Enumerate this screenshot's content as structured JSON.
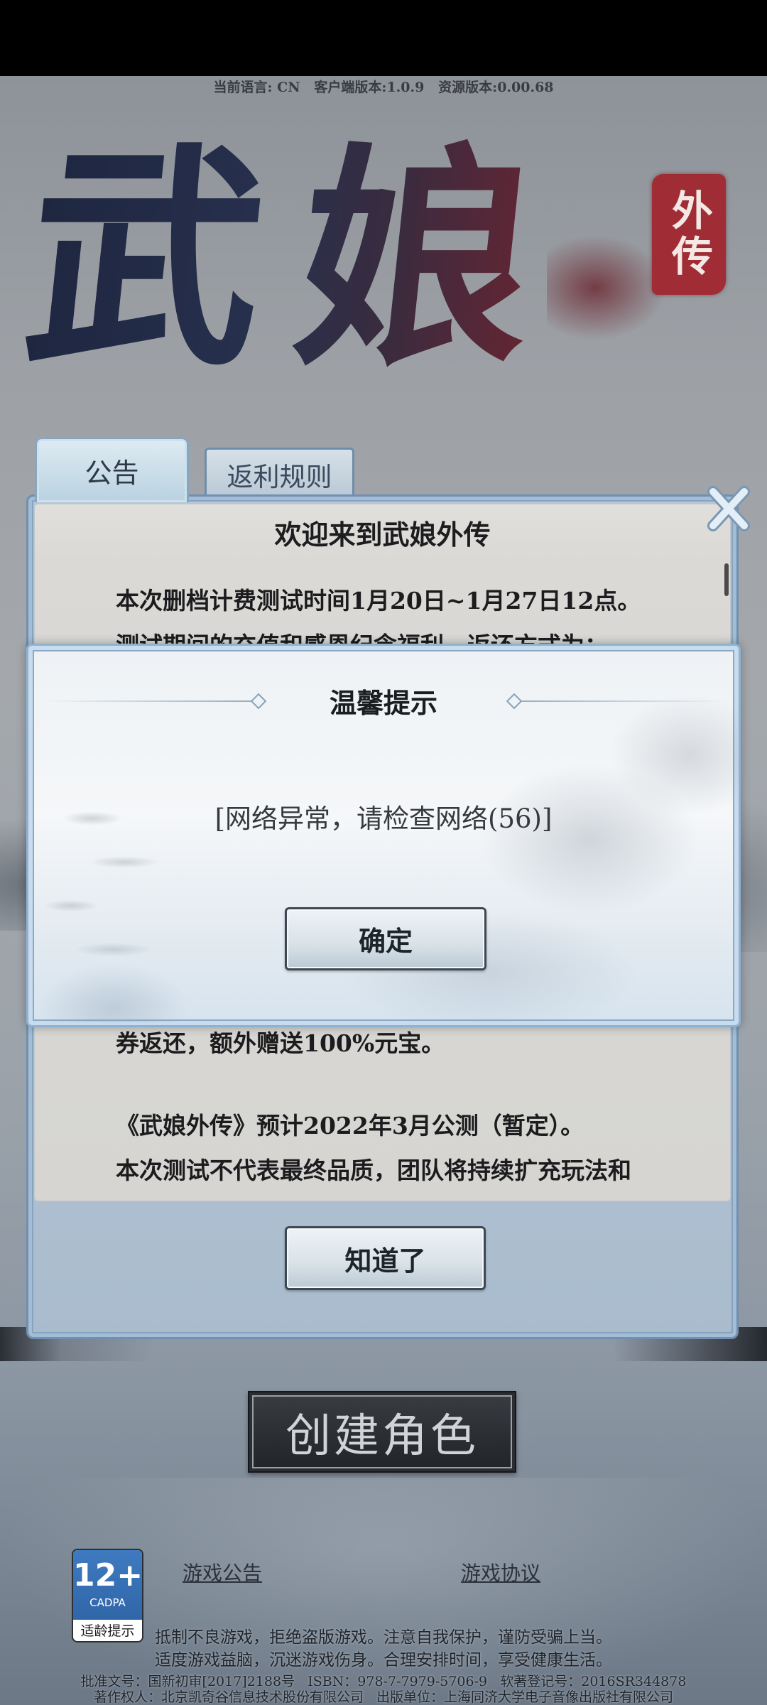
{
  "header": {
    "version_info": "当前语言: CN   客户端版本:1.0.9   资源版本:0.00.68"
  },
  "logo": {
    "title": "武娘",
    "seal": "外传"
  },
  "tabs": [
    {
      "label": "公告",
      "active": true
    },
    {
      "label": "返利规则",
      "active": false
    }
  ],
  "announcement": {
    "title": "欢迎来到武娘外传",
    "lines": [
      "本次删档计费测试时间1月20日~1月27日12点。",
      "测试期间的充值和感恩纪念福利，返还方式为：",
      "券返还，额外赠送100%元宝。",
      "《武娘外传》预计2022年3月公测（暂定）。",
      "本次测试不代表最终品质，团队将持续扩充玩法和"
    ],
    "confirm_label": "知道了",
    "close_icon": "close-icon"
  },
  "dialog": {
    "title": "温馨提示",
    "message": "[网络异常，请检查网络(56)]",
    "ok_label": "确定"
  },
  "create_role_label": "创建角色",
  "age_badge": {
    "rating": "12+",
    "org": "CADPA",
    "label": "适龄提示"
  },
  "footer": {
    "links": [
      "游戏公告",
      "游戏协议"
    ],
    "health_notice": [
      "抵制不良游戏，拒绝盗版游戏。注意自我保护，谨防受骗上当。",
      "适度游戏益脑，沉迷游戏伤身。合理安排时间，享受健康生活。"
    ],
    "license": [
      "批准文号：国新初审[2017]2188号   ISBN：978-7-7979-5706-9   软著登记号：2016SR344878",
      "著作权人：北京凯奇谷信息技术股份有限公司   出版单位：上海同济大学电子音像出版社有限公司"
    ]
  },
  "colors": {
    "panel_frame": "#b6c7d7",
    "panel_border": "#6f90b0",
    "seal_red": "#a02d36",
    "badge_blue": "#2f66a8",
    "create_button_bg": "#2c2f34",
    "create_button_text": "#d0d4d7"
  }
}
